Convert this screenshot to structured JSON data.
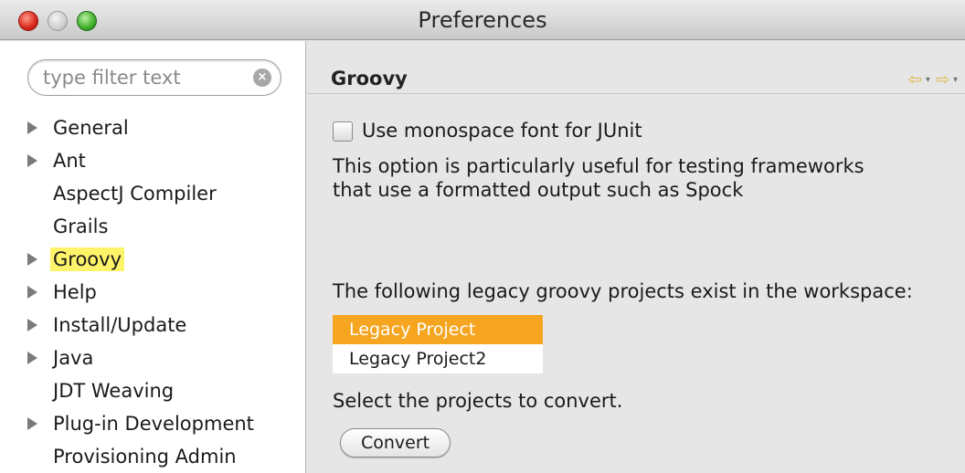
{
  "window": {
    "title": "Preferences"
  },
  "sidebar": {
    "filter_placeholder": "type filter text",
    "items": [
      {
        "label": "General",
        "expandable": true,
        "selected": false
      },
      {
        "label": "Ant",
        "expandable": true,
        "selected": false
      },
      {
        "label": "AspectJ Compiler",
        "expandable": false,
        "selected": false
      },
      {
        "label": "Grails",
        "expandable": false,
        "selected": false
      },
      {
        "label": "Groovy",
        "expandable": true,
        "selected": true
      },
      {
        "label": "Help",
        "expandable": true,
        "selected": false
      },
      {
        "label": "Install/Update",
        "expandable": true,
        "selected": false
      },
      {
        "label": "Java",
        "expandable": true,
        "selected": false
      },
      {
        "label": "JDT Weaving",
        "expandable": false,
        "selected": false
      },
      {
        "label": "Plug-in Development",
        "expandable": true,
        "selected": false
      },
      {
        "label": "Provisioning Admin",
        "expandable": false,
        "selected": false
      }
    ]
  },
  "main": {
    "title": "Groovy",
    "checkbox_label": "Use monospace font for JUnit",
    "checkbox_checked": false,
    "description_line1": "This option is particularly useful for testing frameworks",
    "description_line2": "that use a formatted output such as Spock",
    "legacy_label": "The following legacy groovy projects exist in the workspace:",
    "projects": [
      {
        "name": "Legacy Project",
        "selected": true
      },
      {
        "name": "Legacy Project2",
        "selected": false
      }
    ],
    "select_text": "Select the projects to convert.",
    "convert_label": "Convert"
  },
  "colors": {
    "selection_highlight": "#fff36a",
    "list_selection": "#f5a51f"
  },
  "icons": {
    "back": "back-arrow-icon",
    "forward": "forward-arrow-icon",
    "clear": "clear-search-icon"
  }
}
